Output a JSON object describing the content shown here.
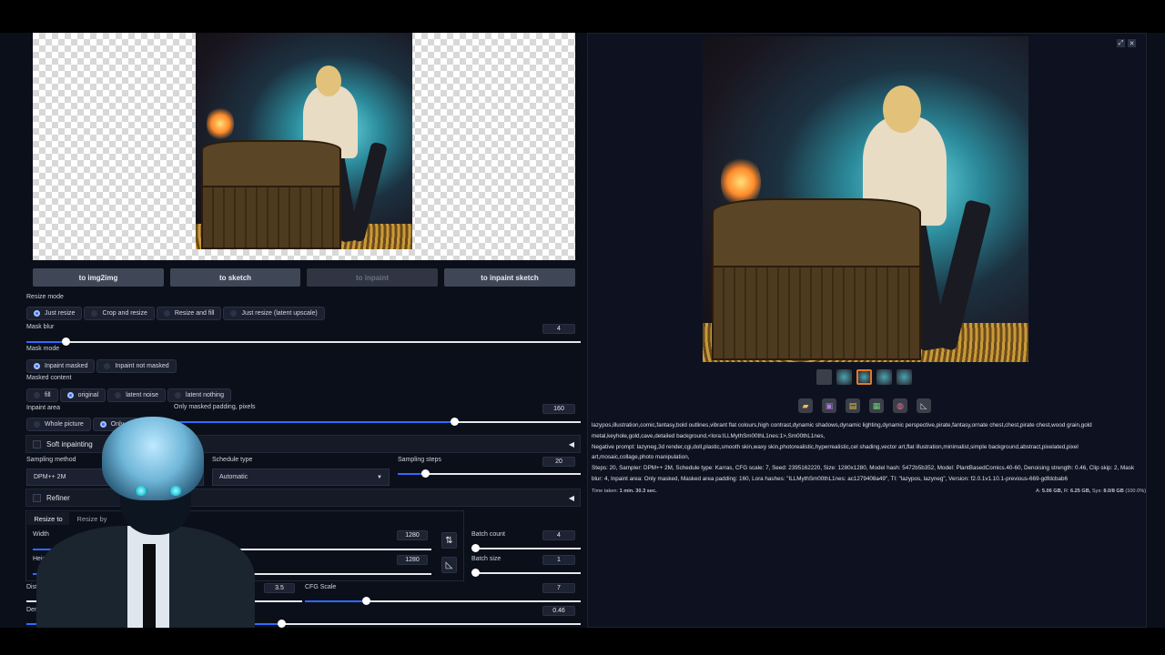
{
  "buttons": {
    "to_img2img": "to img2img",
    "to_sketch": "to sketch",
    "to_inpaint": "to inpaint",
    "to_inpaint_sketch": "to inpaint sketch"
  },
  "resize_mode": {
    "label": "Resize mode",
    "options": [
      "Just resize",
      "Crop and resize",
      "Resize and fill",
      "Just resize (latent upscale)"
    ]
  },
  "mask_blur": {
    "label": "Mask blur",
    "value": "4"
  },
  "mask_mode": {
    "label": "Mask mode",
    "options": [
      "Inpaint masked",
      "Inpaint not masked"
    ]
  },
  "masked_content": {
    "label": "Masked content",
    "options": [
      "fill",
      "original",
      "latent noise",
      "latent nothing"
    ]
  },
  "inpaint_area": {
    "label": "Inpaint area",
    "options": [
      "Whole picture",
      "Only m"
    ]
  },
  "padding": {
    "label": "Only masked padding, pixels",
    "value": "160"
  },
  "soft_inpainting": {
    "label": "Soft inpainting"
  },
  "sampling_method": {
    "label": "Sampling method",
    "value": "DPM++ 2M"
  },
  "schedule_type": {
    "label": "Schedule type",
    "value": "Automatic"
  },
  "sampling_steps": {
    "label": "Sampling steps",
    "value": "20"
  },
  "refiner": {
    "label": "Refiner"
  },
  "resize_tabs": [
    "Resize to",
    "Resize by"
  ],
  "width": {
    "label": "Width",
    "value": "1280"
  },
  "height": {
    "label": "Height",
    "value": "1280"
  },
  "batch_count": {
    "label": "Batch count",
    "value": "4"
  },
  "batch_size": {
    "label": "Batch size",
    "value": "1"
  },
  "distilled_cfg": {
    "label": "Distilled CFG",
    "value": "3.5"
  },
  "cfg_scale": {
    "label": "CFG Scale",
    "value": "7"
  },
  "denoising": {
    "label": "Denoising",
    "value": "0.46"
  },
  "levels": {
    "mask_blur": 0.07,
    "padding": 0.69,
    "sampling_steps": 0.15,
    "width": 0.5,
    "height": 0.5,
    "batch_count": 0.03,
    "batch_size": 0.0,
    "cfg_scale": 0.22,
    "denoising": 0.46
  },
  "output": {
    "info_lines": [
      "lazypos,illustration,comic,fantasy,bold outlines,vibrant flat colours,high contrast,dynamic shadows,dynamic lighting,dynamic perspective,pirate,fantasy,ornate chest,chest,pirate chest,wood grain,gold",
      "metal,keyhole,gold,cave,detailed background,<lora:ILLMythSm00thL1nes:1>,Sm00thL1nes,",
      "Negative prompt: lazyneg,3d render,cgi,doll,plastic,smooth skin,waxy skin,photorealistic,hyperrealistic,cel shading,vector art,flat illustration,minimalist,simple background,abstract,pixelated,pixel",
      "art,mosaic,collage,photo manipulation,",
      "Steps: 20, Sampler: DPM++ 2M, Schedule type: Karras, CFG scale: 7, Seed: 2395162220, Size: 1280x1280, Model hash: 5472b5b352, Model: PlantBasedComics.40-60, Denoising strength: 0.46, Clip skip: 2, Mask",
      "blur: 4, Inpaint area: Only masked, Masked area padding: 160, Lora hashes: \"ILLMythSm00thL1nes: ac1279408a49\", TI: \"lazypos, lazyneg\", Version: f2.0.1v1.10.1-previous-669-gdfdcbab6"
    ],
    "time_label": "Time taken:",
    "time_value": "1 min. 30.3 sec.",
    "mem_a_label": "A:",
    "mem_a": "5.06 GB,",
    "mem_r_label": "R:",
    "mem_r": "6.25 GB,",
    "mem_sys_label": "Sys:",
    "mem_sys": "8.0/8 GB",
    "mem_pct": "(100.0%)"
  },
  "icons": {
    "swap": "⇅",
    "ratio": "◺",
    "folder": "folder-icon",
    "save": "save-icon",
    "zip": "zip-icon",
    "img2img": "image-icon",
    "palette": "palette-icon",
    "ruler": "ruler-icon"
  },
  "colors": {
    "accent": "#2f6bff",
    "panel": "#0b0f19",
    "button": "#3f4756"
  }
}
